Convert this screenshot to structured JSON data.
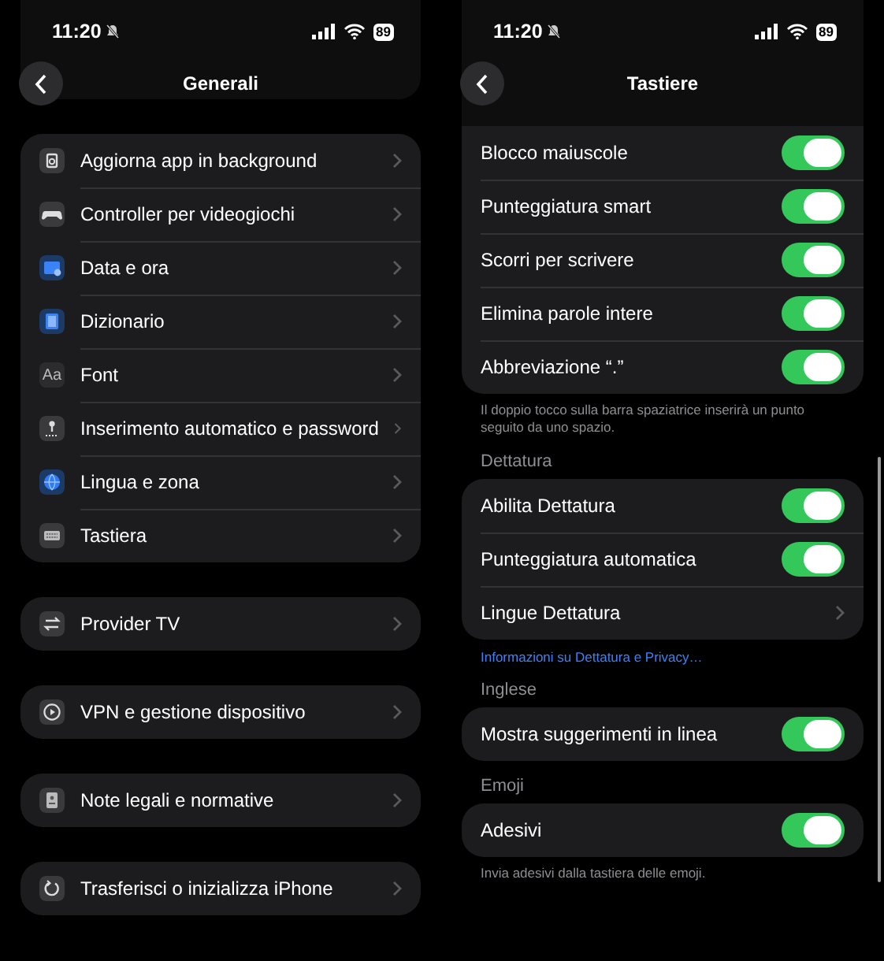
{
  "screens": [
    {
      "status_bar": {
        "time": "11:20",
        "battery": "89"
      },
      "title": "Generali",
      "sections": [
        {
          "rows": [
            {
              "label": "Aggiorna app in background",
              "kind": "link"
            },
            {
              "label": "Controller per videogiochi",
              "kind": "link"
            },
            {
              "label": "Data e ora",
              "kind": "link"
            },
            {
              "label": "Dizionario",
              "kind": "link"
            },
            {
              "label": "Font",
              "kind": "link",
              "icon_glyph": "Aa"
            },
            {
              "label": "Inserimento automatico e password",
              "kind": "link"
            },
            {
              "label": "Lingua e zona",
              "kind": "link"
            },
            {
              "label": "Tastiera",
              "kind": "link"
            }
          ]
        },
        {
          "rows": [
            {
              "label": "Provider TV",
              "kind": "link"
            }
          ]
        },
        {
          "rows": [
            {
              "label": "VPN e gestione dispositivo",
              "kind": "link"
            }
          ]
        },
        {
          "rows": [
            {
              "label": "Note legali e normative",
              "kind": "link"
            }
          ]
        },
        {
          "rows": [
            {
              "label": "Trasferisci o inizializza iPhone",
              "kind": "link"
            }
          ]
        }
      ]
    },
    {
      "status_bar": {
        "time": "11:20",
        "battery": "89"
      },
      "title": "Tastiere",
      "sections": [
        {
          "rows": [
            {
              "label": "Blocco maiuscole",
              "kind": "toggle",
              "on": true
            },
            {
              "label": "Punteggiatura smart",
              "kind": "toggle",
              "on": true
            },
            {
              "label": "Scorri per scrivere",
              "kind": "toggle",
              "on": true
            },
            {
              "label": "Elimina parole intere",
              "kind": "toggle",
              "on": true
            },
            {
              "label": "Abbreviazione “.”",
              "kind": "toggle",
              "on": true
            }
          ],
          "footer": "Il doppio tocco sulla barra spaziatrice inserirà un punto seguito da uno spazio."
        },
        {
          "header": "Dettatura",
          "rows": [
            {
              "label": "Abilita Dettatura",
              "kind": "toggle",
              "on": true
            },
            {
              "label": "Punteggiatura automatica",
              "kind": "toggle",
              "on": true
            },
            {
              "label": "Lingue Dettatura",
              "kind": "link"
            }
          ],
          "footer_link": "Informazioni su Dettatura e Privacy…"
        },
        {
          "header": "Inglese",
          "rows": [
            {
              "label": "Mostra suggerimenti in linea",
              "kind": "toggle",
              "on": true
            }
          ]
        },
        {
          "header": "Emoji",
          "rows": [
            {
              "label": "Adesivi",
              "kind": "toggle",
              "on": true
            }
          ],
          "footer": "Invia adesivi dalla tastiera delle emoji."
        }
      ]
    }
  ]
}
